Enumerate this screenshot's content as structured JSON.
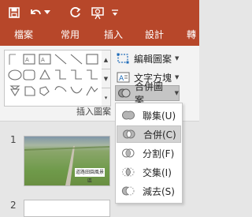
{
  "quick_access": {
    "save_icon": "save-icon",
    "undo_icon": "undo-icon",
    "redo_icon": "redo-icon",
    "present_icon": "present-from-start-icon",
    "more_icon": "customize-qat-icon"
  },
  "tabs": [
    {
      "label": "檔案"
    },
    {
      "label": "常用"
    },
    {
      "label": "插入"
    },
    {
      "label": "設計"
    },
    {
      "label": "轉"
    }
  ],
  "ribbon": {
    "edit_shape_label": "編輯圖案",
    "text_box_label": "文字方塊",
    "merge_shapes_label": "合併圖案",
    "group_label": "插入圖案"
  },
  "merge_menu": {
    "items": [
      {
        "label": "聯集(U)"
      },
      {
        "label": "合併(C)"
      },
      {
        "label": "分割(F)"
      },
      {
        "label": "交集(I)"
      },
      {
        "label": "減去(S)"
      }
    ]
  },
  "slides": {
    "numbers": [
      "1",
      "2"
    ],
    "thumb_title": "道路田園風景區"
  },
  "colors": {
    "accent": "#b7472a"
  }
}
